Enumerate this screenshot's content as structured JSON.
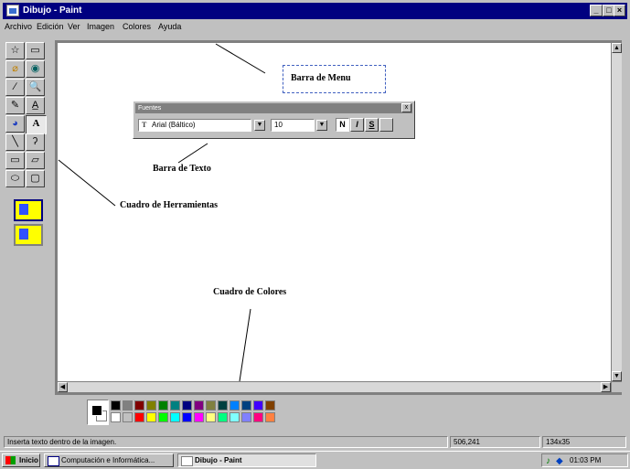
{
  "window": {
    "title": "Dibujo - Paint",
    "min_label": "_",
    "max_label": "□",
    "close_label": "×"
  },
  "menu": [
    "Archivo",
    "Edición",
    "Ver",
    "Imagen",
    "Colores",
    "Ayuda"
  ],
  "toolbox": {
    "tools": [
      "☆",
      "▭",
      "⌀",
      "◉",
      "∕",
      "🔍",
      "✎",
      "A̲",
      "◕",
      "A",
      "╲",
      "ʔ",
      "▭",
      "▱",
      "⬭",
      "▢"
    ],
    "selected_tool": "A"
  },
  "fonts_toolbar": {
    "title": "Fuentes",
    "close_label": "x",
    "font_name": "Arial (Báltico)",
    "font_icon": "T",
    "font_size": "10",
    "bold_label": "N",
    "italic_label": "I",
    "underline_label": "S",
    "vertical_label": ""
  },
  "annotations": {
    "menu_bar": "Barra de Menu",
    "text_bar": "Barra de Texto",
    "toolbox": "Cuadro de Herramientas",
    "colors": "Cuadro de Colores"
  },
  "palette": {
    "foreground": "#000000",
    "background": "#ffffff",
    "row1": [
      "#000000",
      "#808080",
      "#800000",
      "#808000",
      "#008000",
      "#008080",
      "#000080",
      "#800080",
      "#808040",
      "#004040",
      "#0080ff",
      "#004080",
      "#4000ff",
      "#804000"
    ],
    "row2": [
      "#ffffff",
      "#c0c0c0",
      "#ff0000",
      "#ffff00",
      "#00ff00",
      "#00ffff",
      "#0000ff",
      "#ff00ff",
      "#ffff80",
      "#00ff80",
      "#80ffff",
      "#8080ff",
      "#ff0080",
      "#ff8040"
    ]
  },
  "status": {
    "message": "Inserta texto dentro de la imagen.",
    "coords": "506,241",
    "size": "134x35"
  },
  "taskbar": {
    "start_label": "Inicio",
    "tasks": [
      "Computación e Informática...",
      "Dibujo - Paint"
    ],
    "active_task": "Dibujo - Paint",
    "time": "01:03 PM"
  }
}
